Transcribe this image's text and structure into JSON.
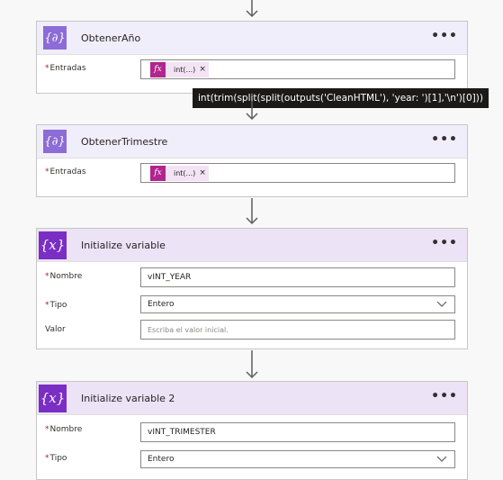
{
  "cards": [
    {
      "kind": "compose",
      "title": "ObtenerAño",
      "icon": "compose-curly-braces-icon",
      "menu": "•••",
      "fields": [
        {
          "label": "Entradas",
          "required": true,
          "token": {
            "fx": "fx",
            "label": "int(...)",
            "remove": "×"
          }
        }
      ]
    },
    {
      "kind": "compose",
      "title": "ObtenerTrimestre",
      "icon": "compose-curly-braces-icon",
      "menu": "•••",
      "fields": [
        {
          "label": "Entradas",
          "required": true,
          "token": {
            "fx": "fx",
            "label": "int(...)",
            "remove": "×"
          }
        }
      ]
    },
    {
      "kind": "variable",
      "title": "Initialize variable",
      "icon": "variable-x-icon",
      "menu": "•••",
      "fields": [
        {
          "label": "Nombre",
          "required": true,
          "value": "vINT_YEAR"
        },
        {
          "label": "Tipo",
          "required": true,
          "value": "Entero"
        },
        {
          "label": "Valor",
          "required": false,
          "placeholder": "Escriba el valor inicial."
        }
      ]
    },
    {
      "kind": "variable",
      "title": "Initialize variable 2",
      "icon": "variable-x-icon",
      "menu": "•••",
      "fields": [
        {
          "label": "Nombre",
          "required": true,
          "value": "vINT_TRIMESTER"
        },
        {
          "label": "Tipo",
          "required": true,
          "value": "Entero"
        }
      ]
    }
  ],
  "tooltip": "int(trim(split(split(outputs('CleanHTML'), 'year: ')[1],'\\n')[0]))",
  "glyphs": {
    "required": "*",
    "compose_icon": "{∂}",
    "variable_icon": "{x}"
  },
  "colors": {
    "compose_header": "#f1eefb",
    "variable_header": "#ece3f7",
    "compose_icon": "#8c6cd6",
    "variable_icon": "#7a2ec4",
    "token": "#b2248e"
  }
}
